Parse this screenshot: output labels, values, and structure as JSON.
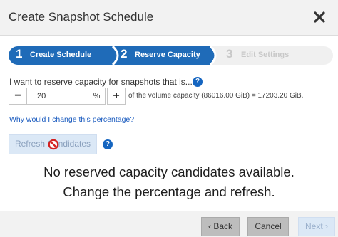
{
  "dialog": {
    "title": "Create Snapshot Schedule",
    "close_icon": "close-icon"
  },
  "wizard": {
    "steps": [
      {
        "number": "1",
        "label": "Create Schedule",
        "state": "completed"
      },
      {
        "number": "2",
        "label": "Reserve Capacity",
        "state": "active"
      },
      {
        "number": "3",
        "label": "Edit Settings",
        "state": "disabled"
      }
    ],
    "colors": {
      "active": "#1f6bb8",
      "disabled": "#f0f0f0"
    }
  },
  "reserve": {
    "question": "I want to reserve capacity for snapshots that is...",
    "minus_label": "−",
    "value": "20",
    "unit": "%",
    "plus_label": "+",
    "capacity_text": "of the volume capacity (86016.00 GiB) = 17203.20 GiB.",
    "why_link": "Why would I change this percentage?"
  },
  "refresh": {
    "label": "Refresh Candidates",
    "help_icon": "help-icon"
  },
  "message": {
    "line1": "No reserved capacity candidates available.",
    "line2": "Change the percentage and refresh."
  },
  "footer": {
    "back_label": "Back",
    "cancel_label": "Cancel",
    "next_label": "Next"
  }
}
